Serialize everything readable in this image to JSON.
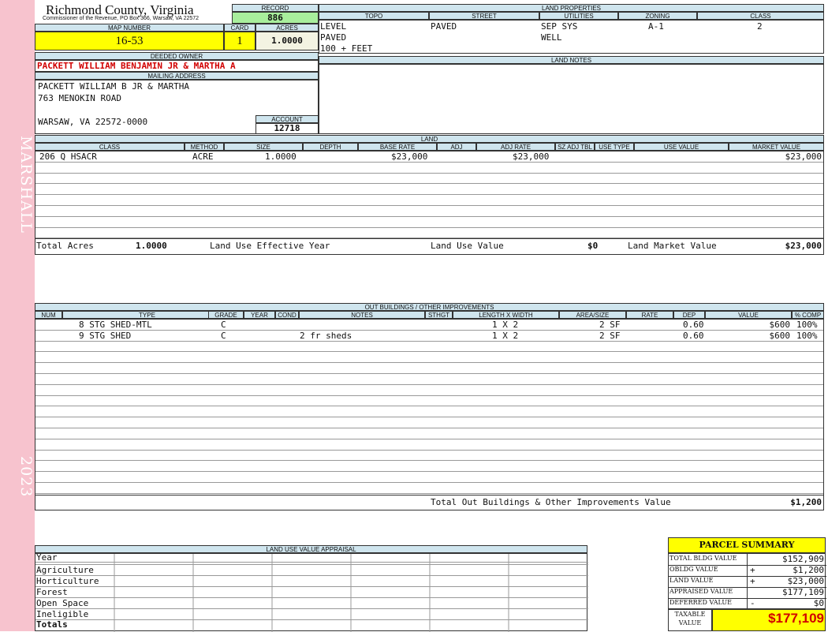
{
  "sidebar": {
    "top_text": "MARSHALL",
    "bottom_text": "2023"
  },
  "header": {
    "county": "Richmond County, Virginia",
    "commissioner": "Commissioner of the Revenue, PO Box 366, Warsaw, VA 22572",
    "record_label": "RECORD",
    "record_value": "886",
    "map_label": "MAP NUMBER",
    "map_value": "16-53",
    "card_label": "CARD",
    "card_value": "1",
    "acres_label": "ACRES",
    "acres_value": "1.0000",
    "owner_label": "DEEDED OWNER",
    "owner_value": "PACKETT WILLIAM BENJAMIN JR & MARTHA A",
    "mailing_label": "MAILING ADDRESS",
    "mailing_lines": [
      "PACKETT WILLIAM B JR & MARTHA",
      "763 MENOKIN ROAD",
      "WARSAW, VA 22572-0000"
    ],
    "account_label": "ACCOUNT",
    "account_value": "12718"
  },
  "land_properties": {
    "title": "LAND PROPERTIES",
    "columns": [
      "TOPO",
      "STREET",
      "UTILITIES",
      "ZONING",
      "CLASS"
    ],
    "topo": [
      "LEVEL",
      "PAVED",
      "100 + FEET"
    ],
    "street": "PAVED",
    "utilities": [
      "SEP SYS",
      "WELL"
    ],
    "zoning": "A-1",
    "class": "2"
  },
  "land_notes": {
    "title": "LAND NOTES"
  },
  "land": {
    "title": "LAND",
    "columns": [
      "CLASS",
      "METHOD",
      "SIZE",
      "DEPTH",
      "BASE RATE",
      "ADJ",
      "ADJ RATE",
      "SZ ADJ TBL",
      "USE TYPE",
      "USE VALUE",
      "MARKET VALUE"
    ],
    "row": {
      "class": "206 Q HSACR",
      "method": "ACRE",
      "size": "1.0000",
      "base_rate": "$23,000",
      "adj_rate": "$23,000",
      "market_value": "$23,000"
    },
    "total_acres_label": "Total Acres",
    "total_acres_value": "1.0000",
    "effective_year_label": "Land Use Effective Year",
    "use_value_label": "Land Use Value",
    "use_value_value": "$0",
    "market_value_label": "Land Market Value",
    "market_value_value": "$23,000"
  },
  "outbuildings": {
    "title": "OUT BUILDINGS / OTHER IMPROVEMENTS",
    "columns": [
      "NUM",
      "TYPE",
      "GRADE",
      "YEAR",
      "COND",
      "NOTES",
      "STHGT",
      "LENGTH X WIDTH",
      "AREA/SIZE",
      "RATE",
      "DEP",
      "VALUE",
      "% COMP"
    ],
    "rows": [
      {
        "type": "8 STG SHED-MTL",
        "grade": "C",
        "notes": "",
        "lw": "1 X 2",
        "area": "2 SF",
        "dep": "0.60",
        "value": "$600",
        "comp": "100%"
      },
      {
        "type": "9 STG SHED",
        "grade": "C",
        "notes": "2 fr sheds",
        "lw": "1 X 2",
        "area": "2 SF",
        "dep": "0.60",
        "value": "$600",
        "comp": "100%"
      }
    ],
    "total_label": "Total Out Buildings & Other Improvements Value",
    "total_value": "$1,200"
  },
  "land_use_appraisal": {
    "title": "LAND USE VALUE APPRAISAL",
    "year_label": "Year",
    "categories": [
      "Agriculture",
      "Horticulture",
      "Forest",
      "Open Space",
      "Ineligible"
    ],
    "totals_label": "Totals"
  },
  "parcel_summary": {
    "title": "PARCEL SUMMARY",
    "rows": [
      {
        "label": "TOTAL BLDG VALUE",
        "sign": "",
        "value": "$152,909"
      },
      {
        "label": "OBLDG VALUE",
        "sign": "+",
        "value": "$1,200"
      },
      {
        "label": "LAND VALUE",
        "sign": "+",
        "value": "$23,000"
      },
      {
        "label": "APPRAISED VALUE",
        "sign": "",
        "value": "$177,109"
      },
      {
        "label": "DEFERRED VALUE",
        "sign": "-",
        "value": "$0"
      }
    ],
    "taxable_label_1": "TAXABLE",
    "taxable_label_2": "VALUE",
    "taxable_value": "$177,109"
  },
  "colors": {
    "sidebar": "#f7c3ce",
    "header_blue": "#cfe5ee",
    "highlight_yellow": "#ffff00",
    "record_green": "#a8ee9c",
    "accent_red": "#d10000"
  }
}
